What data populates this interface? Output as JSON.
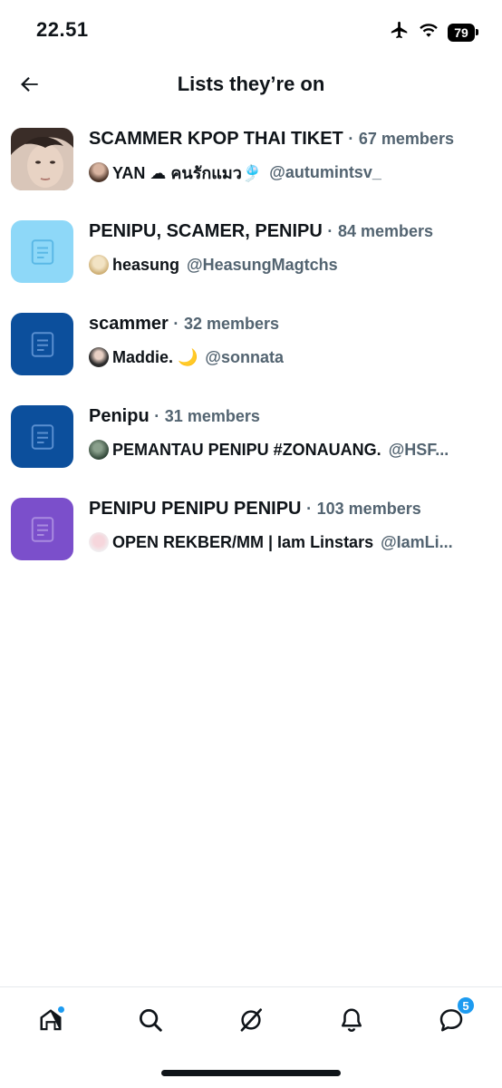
{
  "status_bar": {
    "time": "22.51",
    "battery": "79"
  },
  "header": {
    "title": "Lists they’re on"
  },
  "lists": [
    {
      "name": "SCAMMER KPOP THAI TIKET",
      "separator": "·",
      "members": "67 members",
      "icon_color": "",
      "owner_name": "YAN ☁ คนรักแมว🎐",
      "owner_handle": "@autumintsv_"
    },
    {
      "name": "PENIPU, SCAMER, PENIPU",
      "separator": "·",
      "members": "84 members",
      "icon_color": "#8ed8f8",
      "owner_name": "heasung",
      "owner_handle": "@HeasungMagtchs"
    },
    {
      "name": "scammer",
      "separator": "·",
      "members": "32 members",
      "icon_color": "#0c4f9c",
      "owner_name": "Maddie. 🌙",
      "owner_handle": "@sonnata"
    },
    {
      "name": "Penipu",
      "separator": "·",
      "members": "31 members",
      "icon_color": "#0c4f9c",
      "owner_name": "PEMANTAU PENIPU #ZONAUANG.",
      "owner_handle": "@HSF..."
    },
    {
      "name": "PENIPU PENIPU PENIPU",
      "separator": "·",
      "members": "103 members",
      "icon_color": "#7b4fcb",
      "owner_name": "OPEN REKBER/MM | Iam Linstars",
      "owner_handle": "@IamLi..."
    }
  ],
  "bottom_nav": {
    "items": [
      "home-icon",
      "search-icon",
      "grok-icon",
      "bell-icon",
      "messages-icon"
    ],
    "messages_badge": "5"
  },
  "colors": {
    "accent": "#1d9bf0",
    "secondary_text": "#536471"
  }
}
